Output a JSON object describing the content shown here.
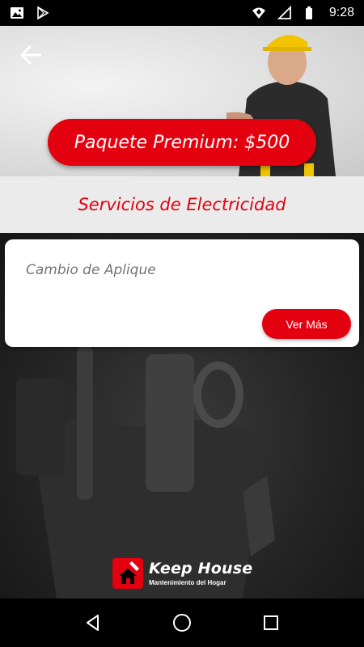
{
  "status_bar": {
    "time": "9:28",
    "left_icons": [
      "image-icon",
      "play-store-icon"
    ],
    "right_icons": [
      "wifi-icon",
      "signal-icon",
      "battery-icon"
    ]
  },
  "hero": {
    "premium_label": "Paquete Premium: $500"
  },
  "section": {
    "title": "Servicios de Electricidad"
  },
  "services": [
    {
      "name": "Cambio de Aplique",
      "action_label": "Ver Más"
    }
  ],
  "logo": {
    "title": "Keep House",
    "subtitle": "Mantenimiento del Hogar"
  },
  "nav": {
    "buttons": [
      "back-icon",
      "home-icon",
      "recents-icon"
    ]
  },
  "colors": {
    "accent": "#e3000f",
    "section_bg": "#ebebeb",
    "card_bg": "#ffffff",
    "service_text": "#757575"
  }
}
